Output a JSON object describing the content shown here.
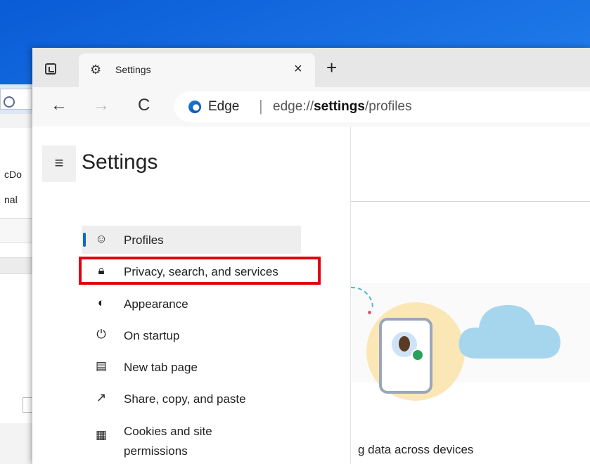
{
  "tab": {
    "title": "Settings",
    "close": "×"
  },
  "newtab_label": "+",
  "nav": {
    "back": "←",
    "forward": "→",
    "reload": "C"
  },
  "address": {
    "brand": "Edge",
    "separator": "|",
    "url_prefix": "edge://",
    "url_bold": "settings",
    "url_suffix": "/profiles"
  },
  "sidebar": {
    "menu_icon": "≡",
    "title": "Settings",
    "items": [
      {
        "label": "Profiles",
        "icon": "profile-icon",
        "glyph": "☺",
        "active": true
      },
      {
        "label": "Privacy, search, and services",
        "icon": "lock-icon",
        "glyph": "🔒︎",
        "highlighted": true
      },
      {
        "label": "Appearance",
        "icon": "palette-icon",
        "glyph": "◐"
      },
      {
        "label": "On startup",
        "icon": "power-icon",
        "glyph": "⏻"
      },
      {
        "label": "New tab page",
        "icon": "new-tab-page-icon",
        "glyph": "▤"
      },
      {
        "label": "Share, copy, and paste",
        "icon": "share-icon",
        "glyph": "↗"
      },
      {
        "label": "Cookies and site",
        "label2": "permissions",
        "icon": "cookies-icon",
        "glyph": "▦"
      }
    ]
  },
  "background_window": {
    "text1": "cDo",
    "text2": "nal"
  },
  "right_caption": "g data across devices",
  "colors": {
    "accent": "#0f6cbd",
    "highlight_border": "#e0000f"
  }
}
